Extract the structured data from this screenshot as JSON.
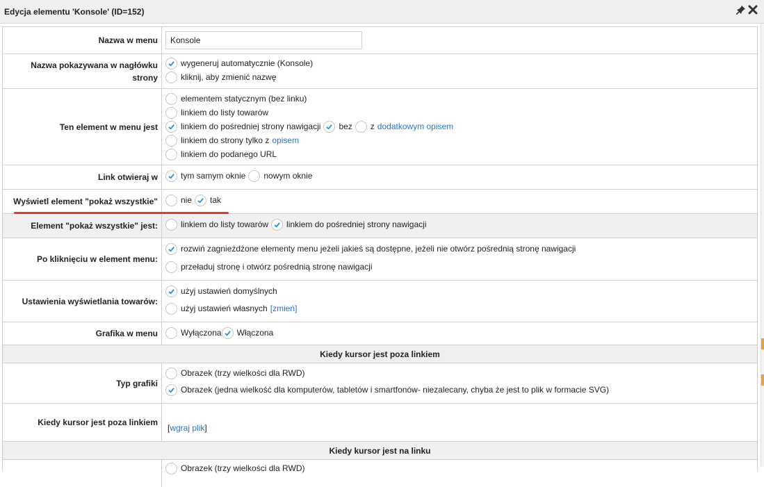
{
  "window": {
    "title": "Edycja elementu 'Konsole' (ID=152)"
  },
  "colors": {
    "accent": "#2a73c7",
    "check": "#2a8fd6",
    "highlight": "#e53a24"
  },
  "rows": {
    "menu_name": {
      "label": "Nazwa w menu",
      "value": "Konsole"
    },
    "header_name": {
      "label": "Nazwa pokazywana w nagłówku strony",
      "opt1": "wygeneruj automatycznie (Konsole)",
      "opt2": "kliknij, aby zmienić nazwę"
    },
    "element_type": {
      "label": "Ten element w menu jest",
      "opt1": "elementem statycznym (bez linku)",
      "opt2": "linkiem do listy towarów",
      "opt3": "linkiem do pośredniej strony nawigacji",
      "opt3_bez": "bez",
      "opt3_z": "z",
      "opt3_link": "dodatkowym opisem",
      "opt4": "linkiem do strony tylko z",
      "opt4_link": "opisem",
      "opt5": "linkiem do podanego URL"
    },
    "link_open": {
      "label": "Link otwieraj w",
      "opt1": "tym samym oknie",
      "opt2": "nowym oknie"
    },
    "show_all": {
      "label": "Wyświetl element \"pokaż wszystkie\"",
      "opt1": "nie",
      "opt2": "tak"
    },
    "show_all_is": {
      "label": "Element \"pokaż wszystkie\" jest:",
      "opt1": "linkiem do listy towarów",
      "opt2": "linkiem do pośredniej strony nawigacji"
    },
    "on_click": {
      "label": "Po kliknięciu w element menu:",
      "opt1": "rozwiń zagnieżdżone elementy menu jeżeli jakieś są dostępne, jeżeli nie otwórz pośrednią stronę nawigacji",
      "opt2": "przeładuj stronę i otwórz pośrednią stronę nawigacji"
    },
    "product_display": {
      "label": "Ustawienia wyświetlania towarów:",
      "opt1": "użyj ustawień domyślnych",
      "opt2": "użyj ustawień własnych",
      "opt2_link": "[zmień]"
    },
    "menu_graphic": {
      "label": "Grafika w menu",
      "opt1": "Wyłączona",
      "opt2": "Włączona"
    },
    "section_outside": "Kiedy kursor jest poza linkiem",
    "graphic_type": {
      "label": "Typ grafiki",
      "opt1": "Obrazek (trzy wielkości dla RWD)",
      "opt2": "Obrazek (jedna wielkość dla komputerów, tabletów i smartfonów- niezalecany, chyba że jest to plik w formacie SVG)"
    },
    "outside_file": {
      "label": "Kiedy kursor jest poza linkiem",
      "open": "[",
      "link": "wgraj plik",
      "close": "]"
    },
    "section_on": "Kiedy kursor jest na linku",
    "partial_opt": "Obrazek (trzy wielkości dla RWD)"
  }
}
